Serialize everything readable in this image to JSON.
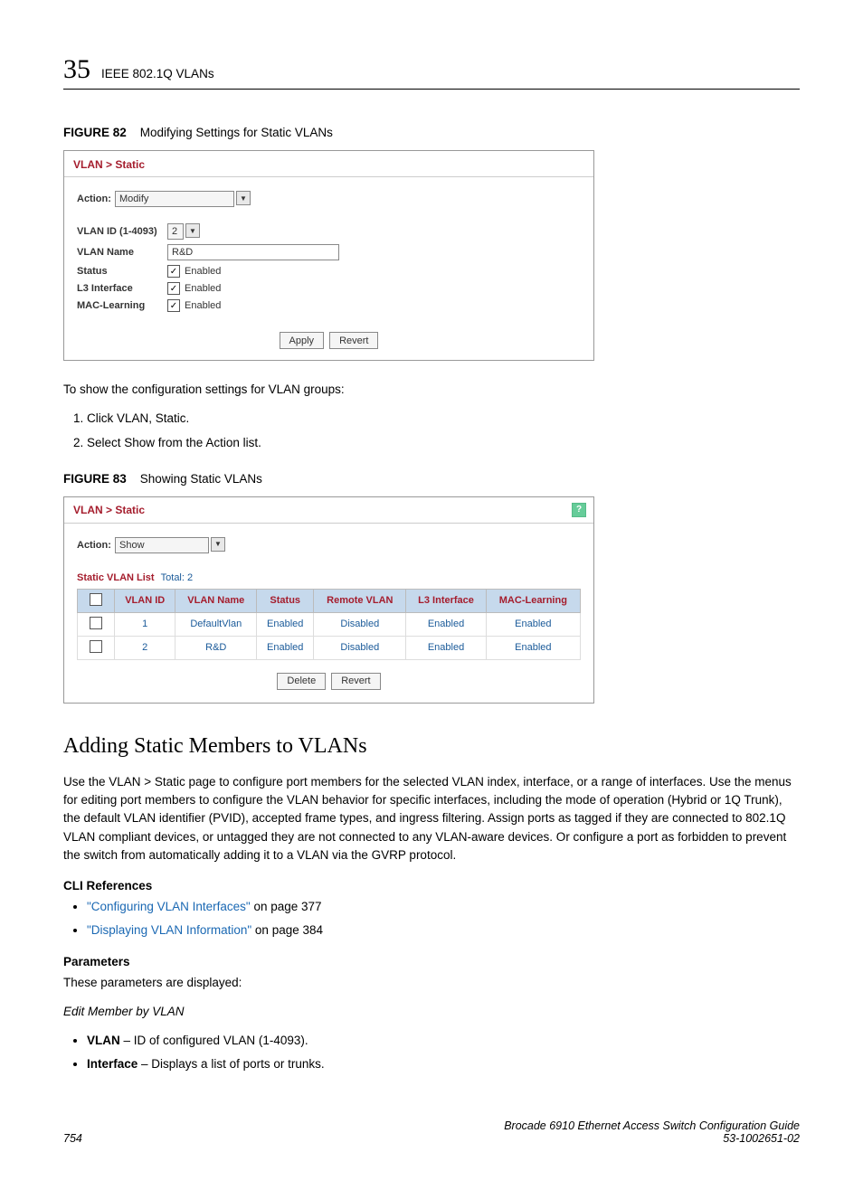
{
  "header": {
    "chapter_number": "35",
    "running_title": "IEEE 802.1Q VLANs"
  },
  "figure82": {
    "label": "FIGURE 82",
    "caption": "Modifying Settings for Static VLANs",
    "breadcrumb": "VLAN > Static",
    "action_label": "Action:",
    "action_value": "Modify",
    "fields": {
      "vlan_id_label": "VLAN ID (1-4093)",
      "vlan_id_value": "2",
      "vlan_name_label": "VLAN Name",
      "vlan_name_value": "R&D",
      "status_label": "Status",
      "l3_label": "L3 Interface",
      "mac_label": "MAC-Learning",
      "enabled_text": "Enabled"
    },
    "buttons": {
      "apply": "Apply",
      "revert": "Revert"
    }
  },
  "body": {
    "intro_text": "To show the configuration settings for VLAN groups:",
    "steps": [
      "Click VLAN, Static.",
      "Select Show from the Action list."
    ]
  },
  "figure83": {
    "label": "FIGURE 83",
    "caption": "Showing Static VLANs",
    "breadcrumb": "VLAN > Static",
    "action_label": "Action:",
    "action_value": "Show",
    "list_label": "Static VLAN List",
    "total_label": "Total: 2",
    "columns": [
      "VLAN ID",
      "VLAN Name",
      "Status",
      "Remote VLAN",
      "L3 Interface",
      "MAC-Learning"
    ],
    "rows": [
      {
        "id": "1",
        "name": "DefaultVlan",
        "status": "Enabled",
        "remote": "Disabled",
        "l3": "Enabled",
        "mac": "Enabled"
      },
      {
        "id": "2",
        "name": "R&D",
        "status": "Enabled",
        "remote": "Disabled",
        "l3": "Enabled",
        "mac": "Enabled"
      }
    ],
    "buttons": {
      "delete": "Delete",
      "revert": "Revert"
    }
  },
  "section": {
    "title": "Adding Static Members to VLANs",
    "paragraph": "Use the VLAN > Static page to configure port members for the selected VLAN index, interface, or a range of interfaces. Use the menus for editing port members to configure the VLAN behavior for specific interfaces, including the mode of operation (Hybrid or 1Q Trunk), the default VLAN identifier (PVID), accepted frame types, and ingress filtering. Assign ports as tagged if they are connected to 802.1Q VLAN compliant devices, or untagged they are not connected to any VLAN-aware devices. Or configure a port as forbidden to prevent the switch from automatically adding it to a VLAN via the GVRP protocol.",
    "cli_heading": "CLI References",
    "cli_refs": [
      {
        "link": "\"Configuring VLAN Interfaces\"",
        "suffix": " on page 377"
      },
      {
        "link": "\"Displaying VLAN Information\"",
        "suffix": " on page 384"
      }
    ],
    "params_heading": "Parameters",
    "params_intro": "These parameters are displayed:",
    "params_subhead": "Edit Member by VLAN",
    "params_items": [
      {
        "term": "VLAN",
        "desc": " – ID of configured VLAN (1-4093)."
      },
      {
        "term": "Interface",
        "desc": " – Displays a list of ports or trunks."
      }
    ]
  },
  "footer": {
    "page_number": "754",
    "doc_title": "Brocade 6910 Ethernet Access Switch Configuration Guide",
    "doc_number": "53-1002651-02"
  }
}
